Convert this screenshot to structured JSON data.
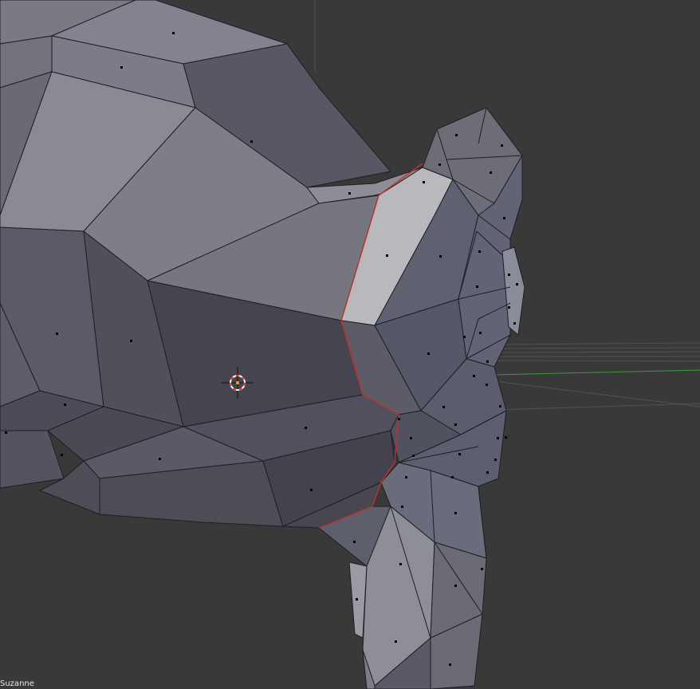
{
  "viewport": {
    "object_label": "Suzanne",
    "background_color": "#393939",
    "seam_color": "#c0322a",
    "grid_color": "#525252",
    "x_axis_color": "#9a3a3a",
    "y_axis_color": "#3f9a3f",
    "mesh_edge_color": "#1e1e24",
    "selected_face_color": "#b9b9bd",
    "vertex_dot_color": "#000000"
  },
  "cursor": {
    "icon": "3d-cursor-icon",
    "ring_colors": [
      "#e23a3a",
      "#ffffff"
    ]
  }
}
